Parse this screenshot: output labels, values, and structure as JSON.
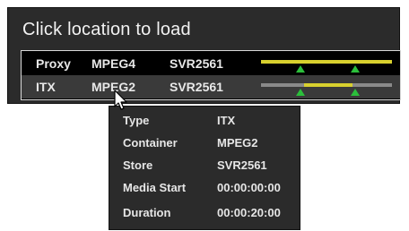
{
  "window": {
    "title": "Click location to load"
  },
  "rows": [
    {
      "label": "Proxy",
      "format": "MPEG4",
      "store": "SVR2561",
      "timeline": {
        "base_color": "#d8d02e",
        "highlight": null,
        "markers": [
          0.3,
          0.72
        ]
      }
    },
    {
      "label": "ITX",
      "format": "MPEG2",
      "store": "SVR2561",
      "timeline": {
        "base_color": "#8a8a8a",
        "highlight": {
          "start": 0.33,
          "end": 0.7,
          "color": "#d8d02e"
        },
        "markers": [
          0.3,
          0.72
        ]
      }
    }
  ],
  "tooltip": {
    "type_label": "Type",
    "type_value": "ITX",
    "container_label": "Container",
    "container_value": "MPEG2",
    "store_label": "Store",
    "store_value": "SVR2561",
    "media_start_label": "Media Start",
    "media_start_value": "00:00:00:00",
    "duration_label": "Duration",
    "duration_value": "00:00:20:00"
  },
  "icons": {
    "cursor": "mouse-pointer-icon",
    "marker": "in-out-marker-icon"
  }
}
